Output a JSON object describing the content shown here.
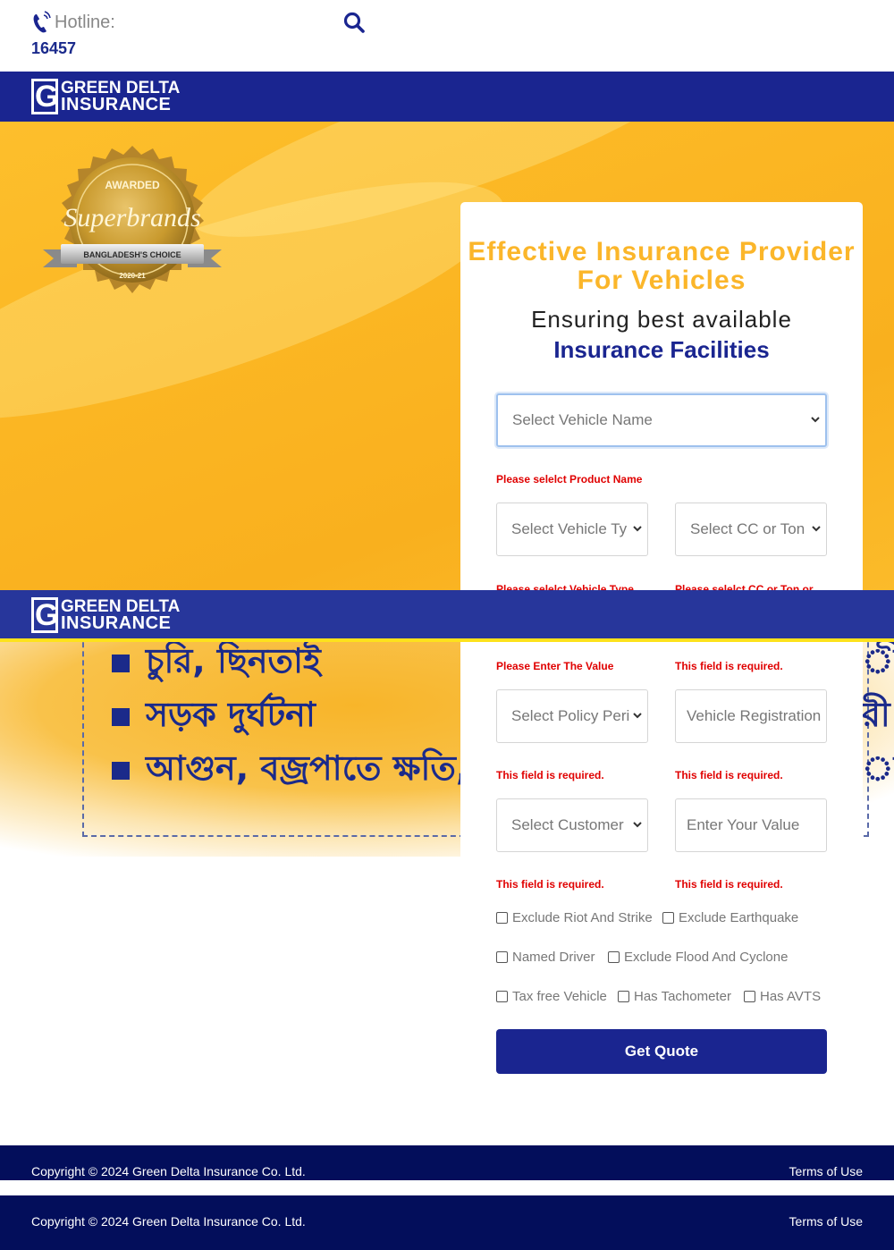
{
  "topbar": {
    "hotline_label": "Hotline:",
    "hotline_number": "16457",
    "icons": {
      "phone": "phone-icon",
      "search": "search-icon"
    }
  },
  "brand": {
    "logo_line1": "GREEN DELTA",
    "logo_line2": "INSURANCE",
    "primary_color": "#1a2590",
    "accent_color": "#fbb62a"
  },
  "hero": {
    "badge": {
      "awarded": "AWARDED",
      "brand": "Superbrands",
      "ribbon": "BANGLADESH'S CHOICE",
      "year": "2020-21"
    }
  },
  "form": {
    "headline": "Effective Insurance Provider For Vehicles",
    "sub_line1": "Ensuring best available",
    "sub_line2": "Insurance Facilities",
    "vehicle_name": {
      "placeholder": "Select Vehicle Name",
      "error": "Please selelct Product Name"
    },
    "vehicle_type": {
      "placeholder": "Select Vehicle Ty",
      "error": "Please selelct Vehicle Type"
    },
    "cc_ton": {
      "placeholder": "Select CC or Ton",
      "error": "Please selelct CC or Ton or"
    },
    "row3_errors": {
      "left": "Please Enter The Value",
      "right": "This field is required."
    },
    "policy_period": {
      "placeholder": "Select Policy Peri",
      "error": "This field is required."
    },
    "registration": {
      "placeholder": "Vehicle Registration",
      "error": "This field is required."
    },
    "customer": {
      "placeholder": "Select Customer",
      "error": "This field is required."
    },
    "value": {
      "placeholder": "Enter Your Value",
      "error": "This field is required."
    },
    "checkboxes": {
      "riot": "Exclude Riot And Strike",
      "earthquake": "Exclude Earthquake",
      "named_driver": "Named Driver",
      "flood": "Exclude Flood And Cyclone",
      "tax_free": "Tax free Vehicle",
      "tachometer": "Has Tachometer",
      "avts": "Has AVTS"
    },
    "submit_label": "Get Quote"
  },
  "banner2": {
    "item1": "চুরি, ছিনতাই",
    "item2": "সড়ক দুর্ঘটনা",
    "item3": "আগুন, বজ্রপাতে ক্ষতি,",
    "right1": "ী ব",
    "right2": "রী",
    "right3": "াঙ"
  },
  "footer": {
    "copyright": "Copyright © 2024 Green Delta Insurance Co. Ltd.",
    "terms": "Terms of Use"
  }
}
